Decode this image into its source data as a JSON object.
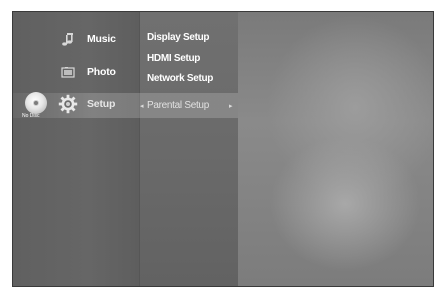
{
  "main_menu": {
    "items": [
      {
        "label": "Music",
        "icon": "music-note-icon"
      },
      {
        "label": "Photo",
        "icon": "photo-icon"
      },
      {
        "label": "Setup",
        "icon": "gear-icon"
      }
    ],
    "selected": "Setup"
  },
  "disc_status": {
    "label": "No Disc",
    "icon": "disc-icon"
  },
  "setup_submenu": {
    "items": [
      {
        "label": "Display Setup"
      },
      {
        "label": "HDMI Setup"
      },
      {
        "label": "Network Setup"
      },
      {
        "label": "Parental Setup",
        "selected": true
      }
    ]
  },
  "colors": {
    "text": "#ffffff",
    "panel_bg": "#5a5a5a",
    "highlight": "rgba(255,255,255,0.18)"
  }
}
